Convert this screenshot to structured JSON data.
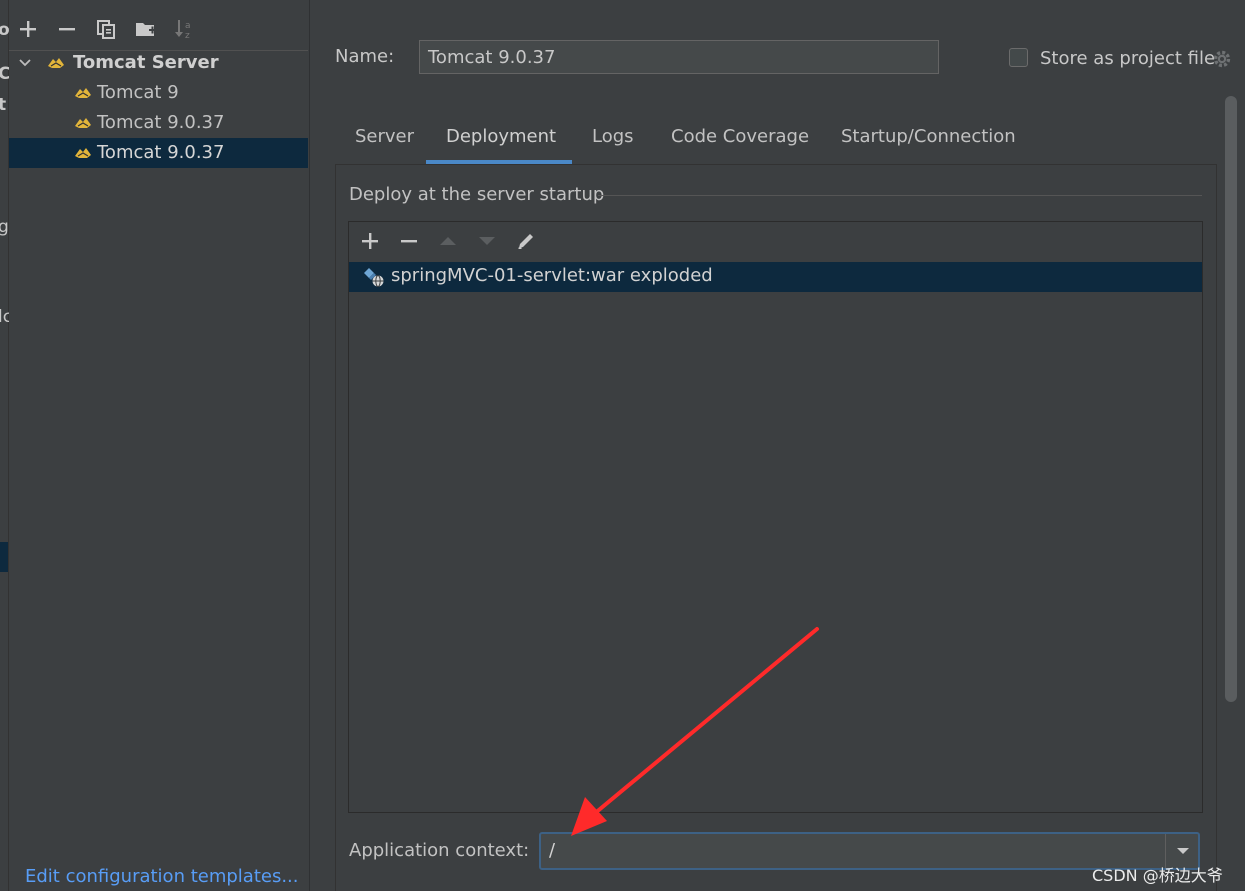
{
  "edge_fragments": [
    "ol",
    "C",
    "t",
    "g",
    "lc"
  ],
  "tree_toolbar": {
    "icons": [
      "add-icon",
      "remove-icon",
      "copy-icon",
      "folder-add-icon",
      "sort-icon"
    ]
  },
  "tree": {
    "group_label": "Tomcat Server",
    "items": [
      {
        "label": "Tomcat 9"
      },
      {
        "label": "Tomcat 9.0.37"
      },
      {
        "label": "Tomcat 9.0.37",
        "selected": true
      }
    ]
  },
  "footer": {
    "edit_templates": "Edit configuration templates..."
  },
  "config": {
    "name_label": "Name:",
    "name_value": "Tomcat 9.0.37",
    "store_label": "Store as project file",
    "store_checked": false
  },
  "tabs": [
    {
      "label": "Server"
    },
    {
      "label": "Deployment",
      "active": true
    },
    {
      "label": "Logs"
    },
    {
      "label": "Code Coverage"
    },
    {
      "label": "Startup/Connection"
    }
  ],
  "deployment": {
    "title": "Deploy at the server startup",
    "toolbar_icons": [
      "add-icon",
      "remove-icon",
      "move-up-icon",
      "move-down-icon",
      "edit-icon"
    ],
    "artifacts": [
      {
        "label": "springMVC-01-servlet:war exploded",
        "selected": true
      }
    ],
    "context_label": "Application context:",
    "context_value": "/"
  },
  "colors": {
    "background": "#3c3f41",
    "selection": "#0d293e",
    "accent": "#4a88c7",
    "link": "#589df6",
    "annotation_arrow": "#ff2a2a"
  },
  "watermark": "CSDN @桥边大爷"
}
